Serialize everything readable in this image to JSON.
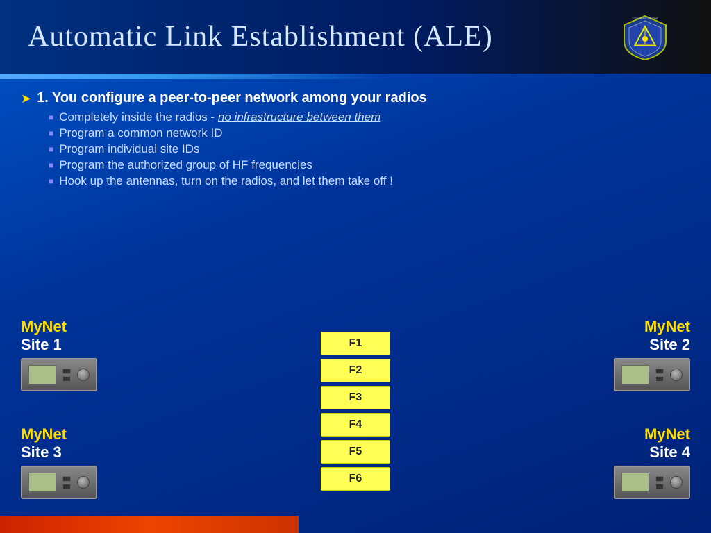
{
  "header": {
    "title": "Automatic Link Establishment (ALE)"
  },
  "content": {
    "main_point": "1. You configure a peer-to-peer network among your radios",
    "sub_bullets": [
      {
        "text_before": "Completely inside the radios  -  ",
        "link_text": "no infrastructure between them",
        "text_after": ""
      },
      {
        "text_before": "Program a common network ID",
        "link_text": "",
        "text_after": ""
      },
      {
        "text_before": "Program individual site IDs",
        "link_text": "",
        "text_after": ""
      },
      {
        "text_before": "Program the authorized group of HF frequencies",
        "link_text": "",
        "text_after": ""
      },
      {
        "text_before": "Hook up the antennas, turn on the radios, and let them take off !",
        "link_text": "",
        "text_after": ""
      }
    ]
  },
  "sites": [
    {
      "id": "site1",
      "mynet": "MyNet",
      "site": "Site 1",
      "position": "top-left"
    },
    {
      "id": "site2",
      "mynet": "MyNet",
      "site": "Site 2",
      "position": "top-right"
    },
    {
      "id": "site3",
      "mynet": "MyNet",
      "site": "Site 3",
      "position": "bottom-left"
    },
    {
      "id": "site4",
      "mynet": "MyNet",
      "site": "Site 4",
      "position": "bottom-right"
    }
  ],
  "frequencies": [
    "F1",
    "F2",
    "F3",
    "F4",
    "F5",
    "F6"
  ],
  "colors": {
    "background": "#0047AB",
    "header_bg": "#001a5e",
    "title_color": "#d4e8ff",
    "accent_yellow": "#ffdd00",
    "freq_bg": "#ffff55"
  }
}
